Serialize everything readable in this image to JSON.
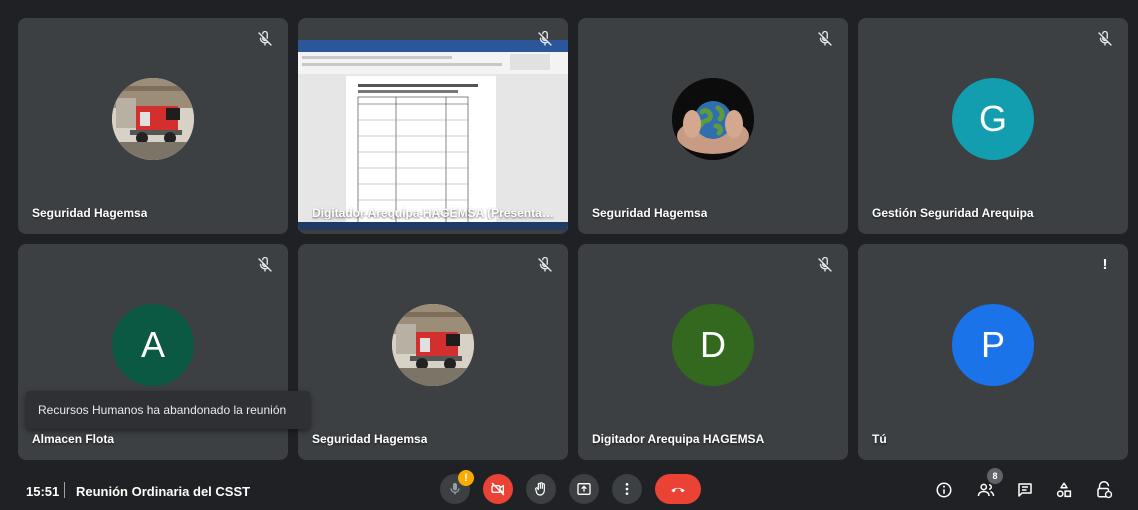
{
  "tiles": [
    {
      "name": "Seguridad Hagemsa",
      "avatar": "truck-photo"
    },
    {
      "name": "Digitador Arequipa HAGEMSA (Presentaci...",
      "avatar": "screen-share"
    },
    {
      "name": "Seguridad Hagemsa",
      "avatar": "earth-in-hands-photo"
    },
    {
      "name": "Gestión Seguridad Arequipa",
      "letter": "G",
      "color": "#129eaf"
    },
    {
      "name": "Almacen Flota",
      "letter": "A",
      "color": "#0b5843"
    },
    {
      "name": "Seguridad Hagemsa",
      "avatar": "truck-photo"
    },
    {
      "name": "Digitador Arequipa HAGEMSA",
      "letter": "D",
      "color": "#33691e"
    },
    {
      "name": "Tú",
      "letter": "P",
      "color": "#1a73e8"
    }
  ],
  "toast": {
    "text": "Recursos Humanos ha abandonado la reunión"
  },
  "footer": {
    "time": "15:51",
    "meeting_title": "Reunión Ordinaria del CSST"
  },
  "controls": {
    "people_count": "8",
    "alert": "!"
  },
  "colors": {
    "background": "#202124",
    "tile": "#3c4043",
    "danger": "#ea4335",
    "warning": "#f9ab00"
  }
}
